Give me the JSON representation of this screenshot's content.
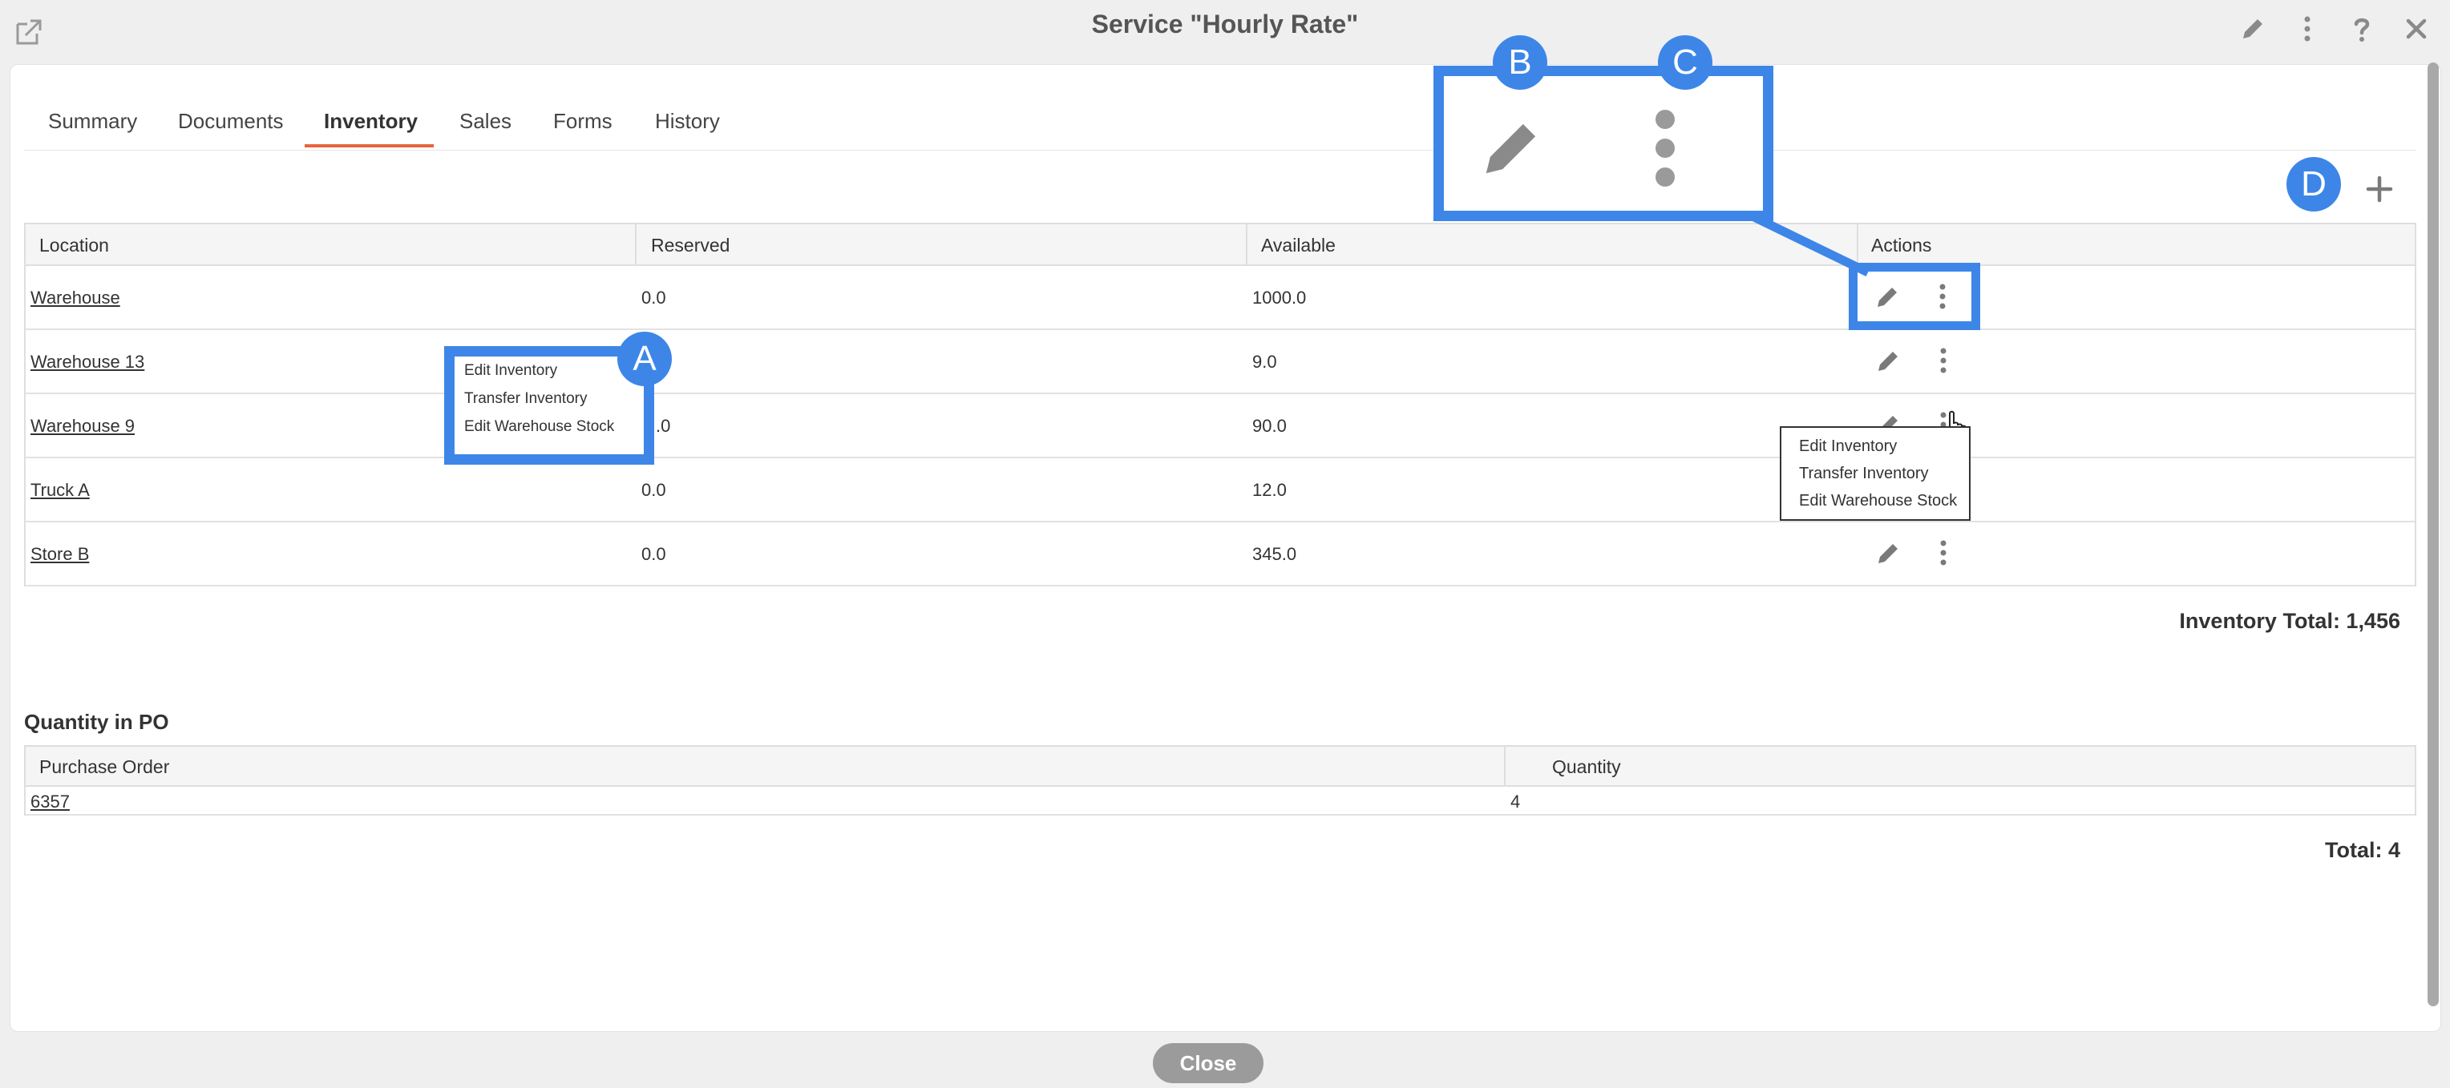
{
  "window": {
    "title": "Service \"Hourly Rate\"",
    "close_button_label": "Close"
  },
  "tabs": [
    {
      "label": "Summary"
    },
    {
      "label": "Documents"
    },
    {
      "label": "Inventory"
    },
    {
      "label": "Sales"
    },
    {
      "label": "Forms"
    },
    {
      "label": "History"
    }
  ],
  "active_tab": "Inventory",
  "inventory_table": {
    "headers": [
      "Location",
      "Reserved",
      "Available",
      "Actions"
    ],
    "rows": [
      {
        "location": "Warehouse",
        "reserved": "0.0",
        "available": "1000.0"
      },
      {
        "location": "Warehouse 13",
        "reserved": "",
        "available": "9.0"
      },
      {
        "location": "Warehouse 9",
        "reserved": ".0",
        "available": "90.0"
      },
      {
        "location": "Truck A",
        "reserved": "0.0",
        "available": "12.0"
      },
      {
        "location": "Store B",
        "reserved": "0.0",
        "available": "345.0"
      }
    ],
    "total_label": "Inventory Total: 1,456"
  },
  "row_menu": {
    "items": [
      "Edit Inventory",
      "Transfer Inventory",
      "Edit Warehouse Stock"
    ]
  },
  "callout_menu": {
    "items": [
      "Edit Inventory",
      "Transfer Inventory",
      "Edit Warehouse Stock"
    ]
  },
  "po_section": {
    "title": "Quantity in PO",
    "headers": [
      "Purchase Order",
      "Quantity"
    ],
    "rows": [
      {
        "po": "6357",
        "quantity": "4"
      }
    ],
    "total_label": "Total: 4"
  },
  "annotations": {
    "a": "A",
    "b": "B",
    "c": "C",
    "d": "D",
    "color": "#3d86e8"
  },
  "icons": {
    "header": [
      "external-link-icon",
      "pencil-icon",
      "more-vertical-icon",
      "help-icon",
      "close-icon"
    ],
    "row_actions": [
      "pencil-icon",
      "more-vertical-icon"
    ],
    "add": "plus-icon"
  },
  "colors": {
    "tab_underline": "#e8643c",
    "icon_gray": "#7a7a7a",
    "close_button": "#9b9b9b"
  }
}
